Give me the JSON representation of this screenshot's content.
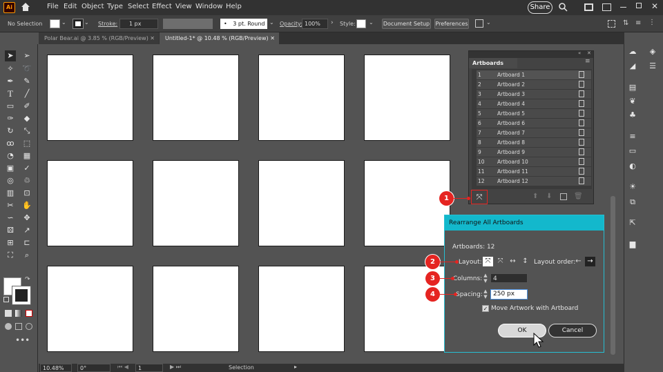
{
  "app": {
    "logo": "Ai"
  },
  "menu": {
    "items": [
      "File",
      "Edit",
      "Object",
      "Type",
      "Select",
      "Effect",
      "View",
      "Window",
      "Help"
    ],
    "share_label": "Share"
  },
  "control": {
    "selection_status": "No Selection",
    "stroke_label": "Stroke:",
    "stroke_weight": "1 px",
    "brush_label": "3 pt. Round",
    "opacity_label": "Opacity:",
    "opacity_value": "100%",
    "style_label": "Style:",
    "document_setup_label": "Document Setup",
    "preferences_label": "Preferences"
  },
  "tabs": [
    {
      "label": "Polar Bear.ai @ 3.85 % (RGB/Preview)",
      "active": false
    },
    {
      "label": "Untitled-1* @ 10.48 % (RGB/Preview)",
      "active": true
    }
  ],
  "artboards_panel": {
    "title": "Artboards",
    "rows": [
      {
        "num": "1",
        "name": "Artboard 1"
      },
      {
        "num": "2",
        "name": "Artboard 2"
      },
      {
        "num": "3",
        "name": "Artboard 3"
      },
      {
        "num": "4",
        "name": "Artboard 4"
      },
      {
        "num": "5",
        "name": "Artboard 5"
      },
      {
        "num": "6",
        "name": "Artboard 6"
      },
      {
        "num": "7",
        "name": "Artboard 7"
      },
      {
        "num": "8",
        "name": "Artboard 8"
      },
      {
        "num": "9",
        "name": "Artboard 9"
      },
      {
        "num": "10",
        "name": "Artboard 10"
      },
      {
        "num": "11",
        "name": "Artboard 11"
      },
      {
        "num": "12",
        "name": "Artboard 12"
      }
    ]
  },
  "dialog": {
    "title": "Rearrange All Artboards",
    "artboards_count_label": "Artboards: 12",
    "layout_label": "Layout:",
    "layout_order_label": "Layout order:",
    "columns_label": "Columns:",
    "columns_value": "4",
    "spacing_label": "Spacing:",
    "spacing_value": "250 px",
    "move_artwork_label": "Move Artwork with Artboard",
    "move_artwork_checked": true,
    "ok_label": "OK",
    "cancel_label": "Cancel"
  },
  "markers": [
    "1",
    "2",
    "3",
    "4"
  ],
  "status": {
    "zoom": "10.48%",
    "rotation": "0°",
    "artboard_index": "1",
    "tool": "Selection"
  },
  "colors": {
    "accent": "#13b8cc",
    "marker": "#e52421",
    "logo": "#ff9a00"
  }
}
